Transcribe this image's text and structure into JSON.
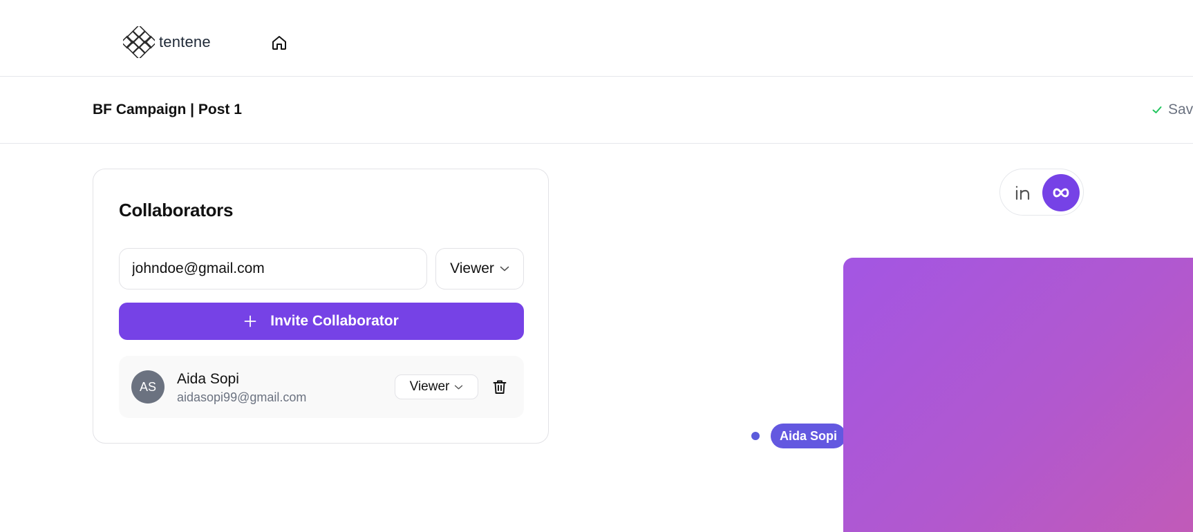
{
  "nav": {
    "logo_text": "tentene",
    "home_icon": "home-icon"
  },
  "header": {
    "title": "BF Campaign | Post 1",
    "save_status": "Saved"
  },
  "collaborators": {
    "title": "Collaborators",
    "email_value": "johndoe@gmail.com",
    "role_selected": "Viewer",
    "invite_label": "Invite Collaborator",
    "list": [
      {
        "initials": "AS",
        "name": "Aida Sopi",
        "email": "aidasopi99@gmail.com",
        "role": "Viewer"
      }
    ]
  },
  "platforms": {
    "items": [
      "linkedin-icon",
      "meta-icon"
    ],
    "active": "meta-icon"
  },
  "cursor": {
    "user": "Aida Sopi"
  },
  "colors": {
    "accent": "#7642e6",
    "cursor": "#6358e0",
    "save_check": "#22c55e",
    "preview_start": "#a356e3",
    "preview_end": "#c15ab8"
  }
}
